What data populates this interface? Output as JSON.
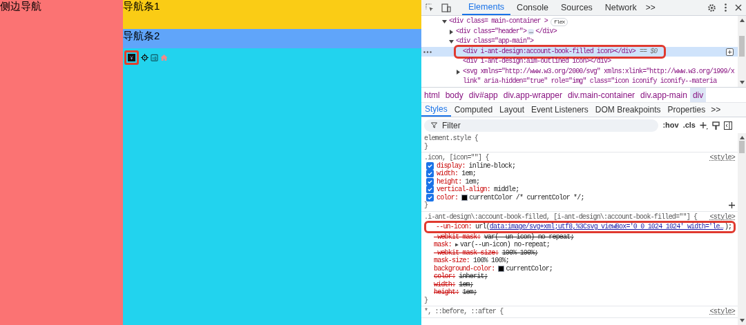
{
  "page": {
    "sidebar": {
      "title": "侧边导航"
    },
    "header": {
      "title": "导航条1"
    },
    "subheader": {
      "title": "导航条2"
    }
  },
  "devtools": {
    "tabs": [
      {
        "label": "Elements",
        "selected": true
      },
      {
        "label": "Console",
        "selected": false
      },
      {
        "label": "Sources",
        "selected": false
      },
      {
        "label": "Network",
        "selected": false
      }
    ],
    "more_tabs": ">>",
    "dom_tree": [
      {
        "kind": "open",
        "text": "<div class= main-container >",
        "badge": "flex",
        "selected": false,
        "children": [
          {
            "kind": "closed",
            "text": "<div class=\"header\">",
            "ellipsis": "…",
            "after": "</div>",
            "selected": false
          },
          {
            "kind": "open",
            "text": "<div class=\"app-main\">",
            "selected": false,
            "children": [
              {
                "kind": "leaf",
                "text": "<div i-ant-design:account-book-filled icon></div>",
                "ref": "== $0",
                "selected": true
              },
              {
                "kind": "leaf",
                "text": "<div i-ant-design:aim-outlined icon></div>",
                "selected": false
              },
              {
                "kind": "closed",
                "text": "<svg xmlns=\"http://www.w3.org/2000/svg\" xmlns:xlink=\"http://www.w3.org/1999/xlink\" aria-hidden=\"true\" role=\"img\" class=\"icon iconify iconify--materia",
                "selected": false
              }
            ]
          }
        ]
      }
    ],
    "breadcrumbs": [
      {
        "label": "html",
        "selected": false
      },
      {
        "label": "body",
        "selected": false
      },
      {
        "label": "div#app",
        "selected": false
      },
      {
        "label": "div.app-wrapper",
        "selected": false
      },
      {
        "label": "div.main-container",
        "selected": false
      },
      {
        "label": "div.app-main",
        "selected": false
      },
      {
        "label": "div",
        "selected": true
      }
    ],
    "panel_tabs": [
      {
        "label": "Styles",
        "selected": true
      },
      {
        "label": "Computed",
        "selected": false
      },
      {
        "label": "Layout",
        "selected": false
      },
      {
        "label": "Event Listeners",
        "selected": false
      },
      {
        "label": "DOM Breakpoints",
        "selected": false
      },
      {
        "label": "Properties",
        "selected": false
      }
    ],
    "more_panel_tabs": ">>",
    "filter": {
      "placeholder": "Filter"
    },
    "filter_buttons": [
      ":hov",
      ".cls"
    ],
    "rules": [
      {
        "selector": "element.style {",
        "close": "}"
      },
      {
        "selector": ".icon, [icon=\"\"] {",
        "source": "<style>",
        "close": "}",
        "add": true,
        "declarations": [
          {
            "property": "display:",
            "value": "inline-block;",
            "checked": true
          },
          {
            "property": "width:",
            "value": "1em;",
            "checked": true
          },
          {
            "property": "height:",
            "value": "1em;",
            "checked": true
          },
          {
            "property": "vertical-align:",
            "value": "middle;",
            "checked": true
          },
          {
            "property": "color:",
            "value": "currentColor /* currentColor */;",
            "checked": true,
            "kind": "color"
          }
        ]
      },
      {
        "selector": ".i-ant-design\\:account-book-filled, [i-ant-design\\:account-book-filled=\"\"] {",
        "source": "<style>",
        "close": "}",
        "declarations": [
          {
            "property": "--un-icon:",
            "value": "url(",
            "link": "data:image/svg+xml;utf8,%3Csvg viewBox='0 0 1024 1024' width='le…",
            "suffix": ");",
            "highlighted": true,
            "struck": false
          },
          {
            "property": "-webkit-mask:",
            "value": "var(--un-icon) no-repeat;",
            "struck": true
          },
          {
            "property": "mask:",
            "expander": "▶",
            "value": "var(--un-icon) no-repeat;",
            "struck": false
          },
          {
            "property": "-webkit-mask-size:",
            "value": "100% 100%;",
            "struck": true
          },
          {
            "property": "mask-size:",
            "value": "100% 100%;",
            "struck": false
          },
          {
            "property": "background-color:",
            "value": "currentColor;",
            "kind": "color",
            "struck": false
          },
          {
            "property": "color:",
            "value": "inherit;",
            "struck": true
          },
          {
            "property": "width:",
            "value": "1em;",
            "struck": true
          },
          {
            "property": "height:",
            "value": "1em;",
            "struck": true
          }
        ]
      },
      {
        "selector": "*, ::before, ::after {",
        "source": "<style>"
      }
    ]
  }
}
